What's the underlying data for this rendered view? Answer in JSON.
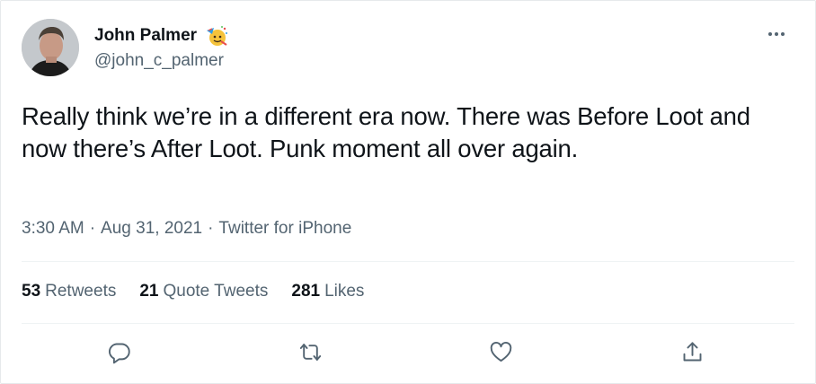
{
  "tweet": {
    "author": {
      "display_name": "John Palmer",
      "handle": "@john_c_palmer",
      "badge_icon": "party-face-icon"
    },
    "text": "Really think we’re in a different era now. There was Before Loot and now there’s After Loot. Punk moment all over again.",
    "time": "3:30 AM",
    "date": "Aug 31, 2021",
    "source": "Twitter for iPhone",
    "separator": "·",
    "stats": [
      {
        "count": "53",
        "label": "Retweets"
      },
      {
        "count": "21",
        "label": "Quote Tweets"
      },
      {
        "count": "281",
        "label": "Likes"
      }
    ],
    "actions": [
      "reply-icon",
      "retweet-icon",
      "like-icon",
      "share-icon"
    ]
  },
  "colors": {
    "text_primary": "#0f1419",
    "text_secondary": "#536471",
    "divider": "#eff3f4"
  }
}
